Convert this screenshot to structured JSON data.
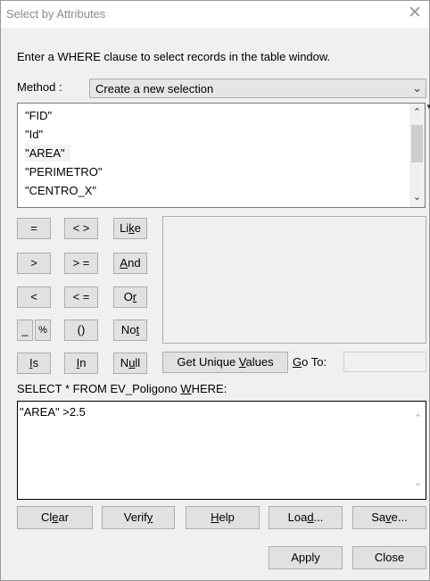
{
  "window": {
    "title": "Select by Attributes"
  },
  "instructions": "Enter a WHERE clause to select records in the table window.",
  "method": {
    "label": "Method :",
    "value": "Create a new selection"
  },
  "fields": [
    "\"FID\"",
    "\"Id\"",
    "\"AREA\"",
    "\"PERIMETRO\"",
    "\"CENTRO_X\""
  ],
  "selected_field": "\"AREA\"",
  "operators": {
    "eq": "=",
    "ne": "< >",
    "like": "Like",
    "gt": ">",
    "ge": "> =",
    "and": "And",
    "lt": "<",
    "le": "< =",
    "or": "Or",
    "underscore": "_",
    "percent": "%",
    "parens": "()",
    "not": "Not",
    "is": "Is",
    "in": "In",
    "null": "Null"
  },
  "get_unique_values": "Get Unique Values",
  "go_to": "Go To:",
  "query_prefix": "SELECT * FROM EV_Poligono WHERE:",
  "expression": "\"AREA\" >2.5",
  "buttons": {
    "clear": "Clear",
    "verify": "Verify",
    "help": "Help",
    "load": "Load...",
    "save": "Save...",
    "apply": "Apply",
    "close": "Close"
  },
  "icons": {
    "close": "close-icon",
    "dropdown": "chevron-down-icon",
    "scroll_up": "scroll-up-icon",
    "scroll_down": "scroll-down-icon"
  }
}
